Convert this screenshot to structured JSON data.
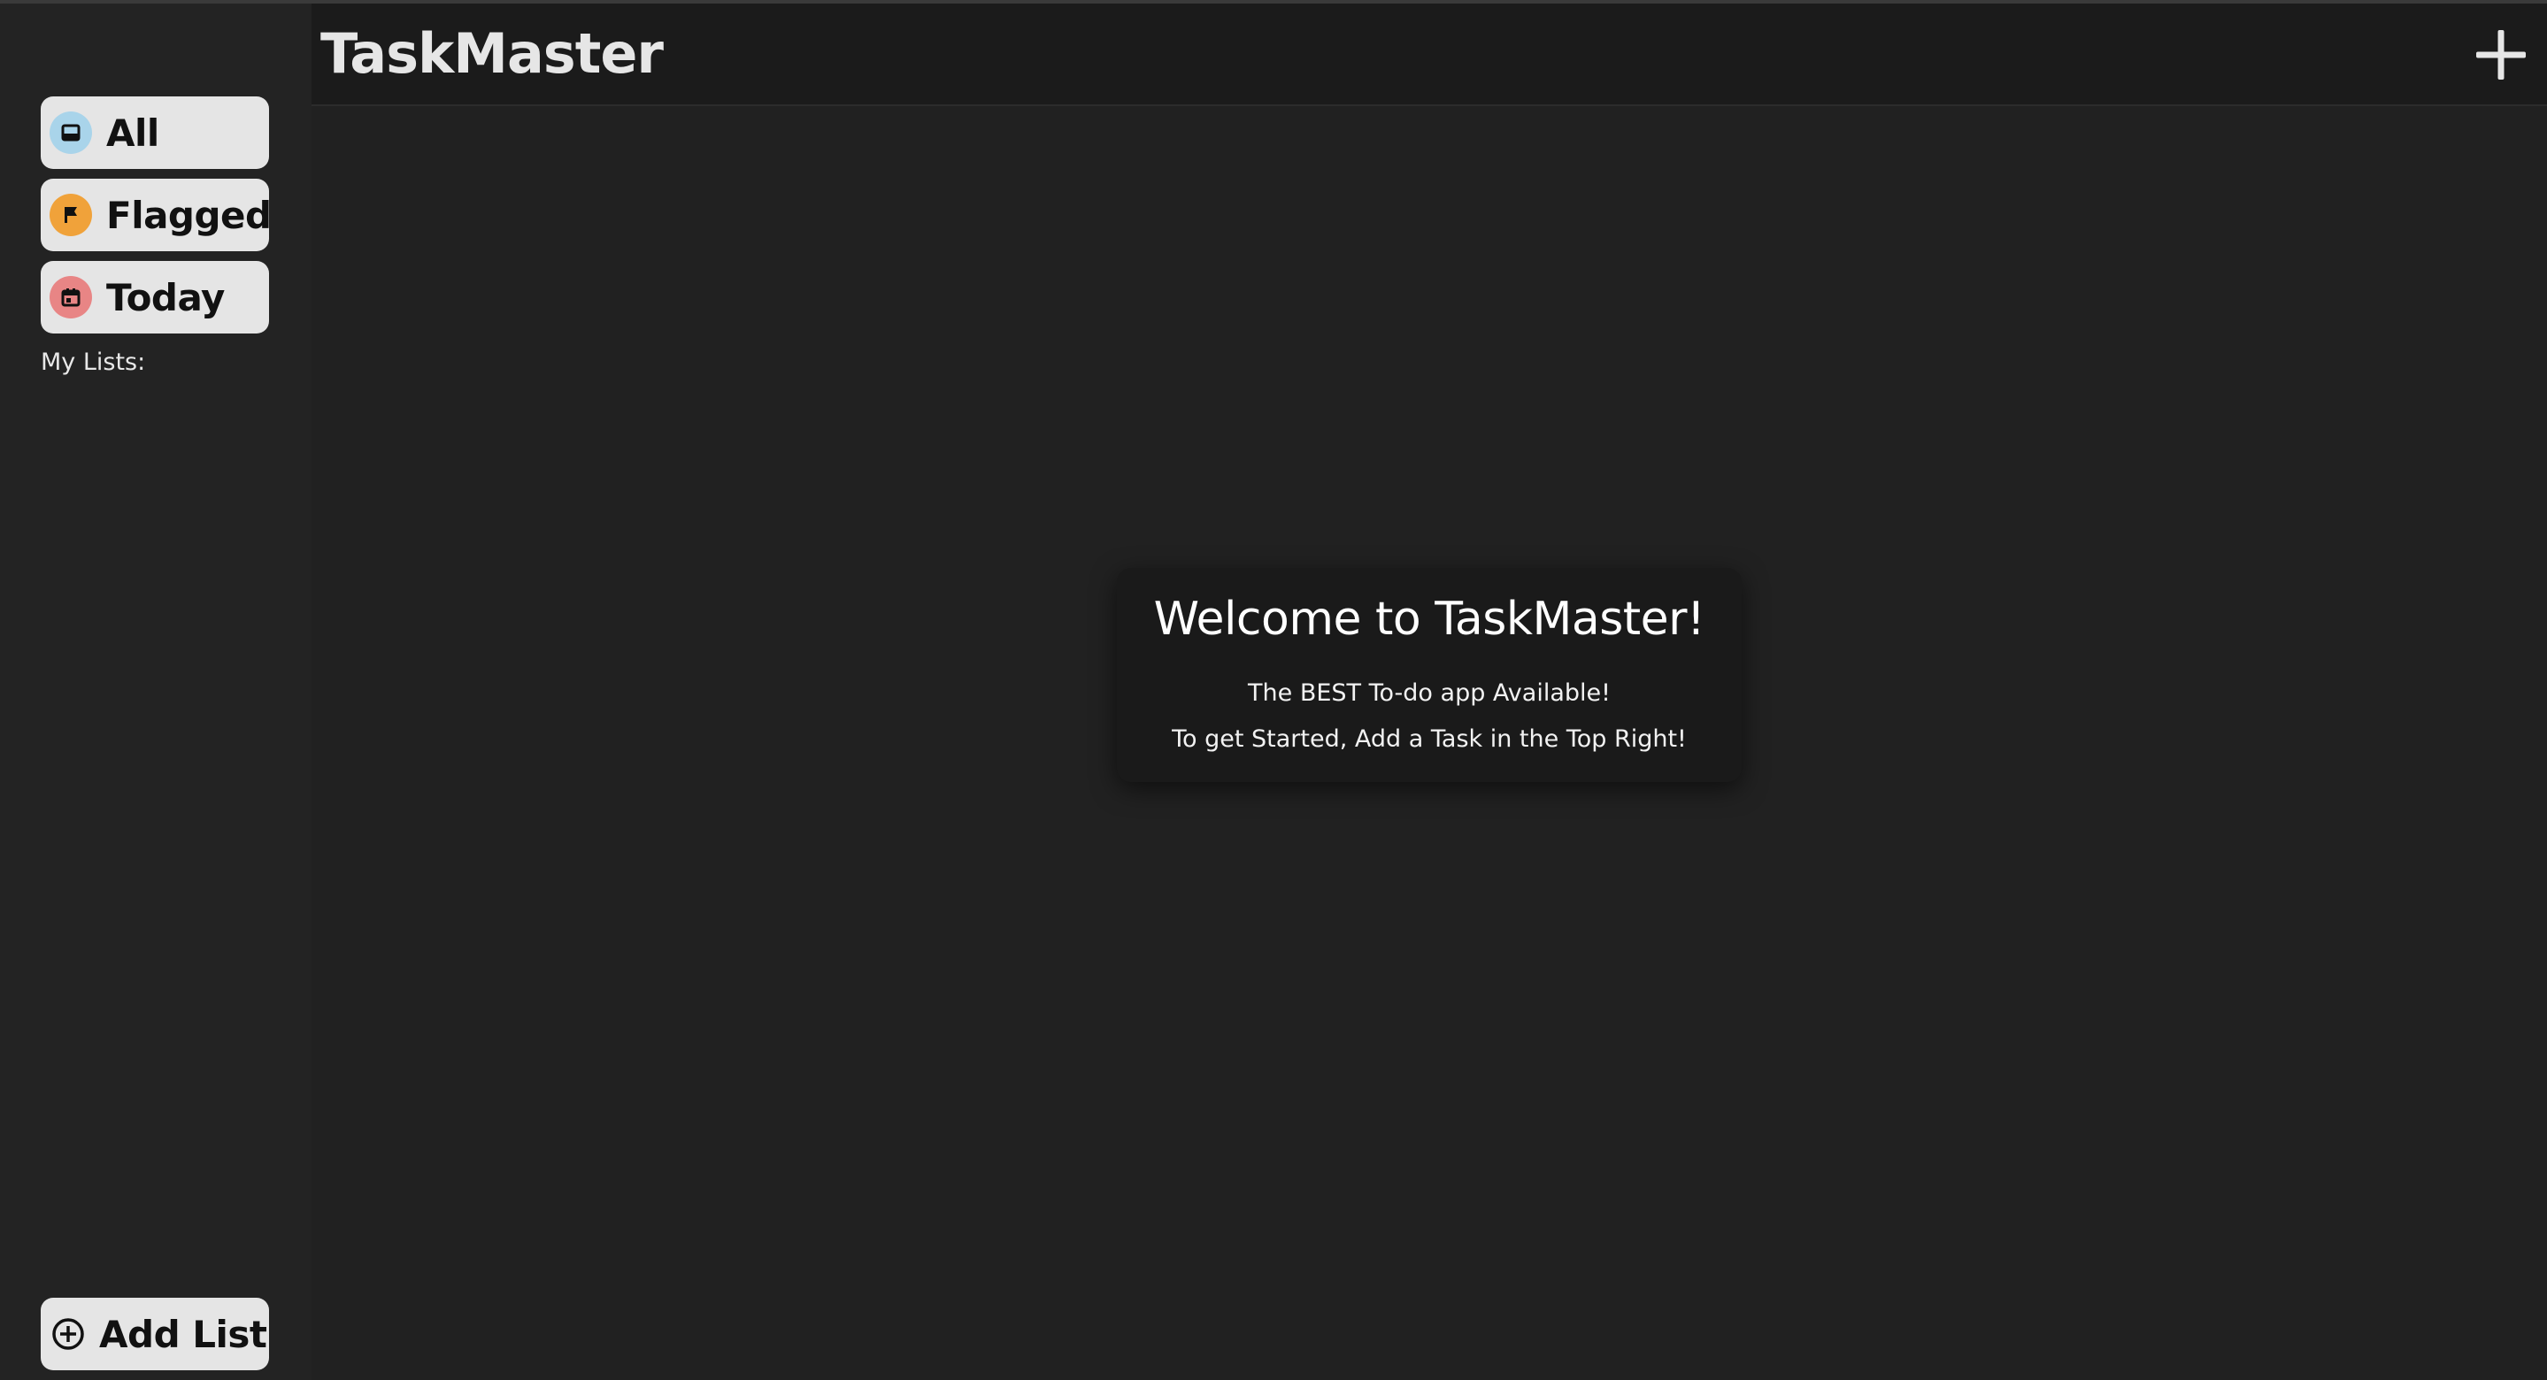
{
  "header": {
    "title": "TaskMaster",
    "add_task_icon": "plus-icon"
  },
  "sidebar": {
    "items": [
      {
        "label": "All",
        "icon": "inbox-icon",
        "color": "#a9d4ea"
      },
      {
        "label": "Flagged",
        "icon": "flag-icon",
        "color": "#f0a23a"
      },
      {
        "label": "Today",
        "icon": "calendar-icon",
        "color": "#e88585"
      }
    ],
    "my_lists_label": "My Lists:",
    "add_list_label": "Add List",
    "add_list_icon": "plus-circle-icon"
  },
  "main": {
    "welcome": {
      "heading": "Welcome to TaskMaster!",
      "line1": "The BEST To-do app Available!",
      "line2": "To get Started, Add a Task in the Top Right!"
    }
  },
  "colors": {
    "background": "#212121",
    "header_background": "#1b1b1b",
    "button_background": "#e5e5e5",
    "card_background": "#1a1a1a"
  }
}
